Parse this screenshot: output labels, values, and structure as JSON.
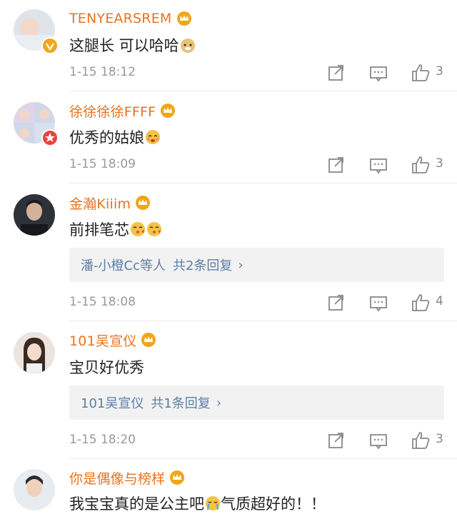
{
  "comments": [
    {
      "user": "TENYEARSREM",
      "text": "这腿长 可以哈哈",
      "emojis": [
        "doge-emoji"
      ],
      "time": "1-15 18:12",
      "likes": "3",
      "badge": "verified-v",
      "badge_color": "#f0a61b"
    },
    {
      "user": "徐徐徐徐FFFF",
      "text": "优秀的姑娘",
      "emojis": [
        "shy-emoji"
      ],
      "time": "1-15 18:09",
      "likes": "3",
      "badge": "star",
      "badge_color": "#e8433a"
    },
    {
      "user": "金瀚Kiiim",
      "text": "前排笔芯",
      "emojis": [
        "kiss-emoji",
        "kiss-emoji"
      ],
      "time": "1-15 18:08",
      "likes": "4",
      "replies": {
        "who": "潘-小橙Cc等人",
        "count": "共2条回复"
      }
    },
    {
      "user": "101吴宣仪",
      "text": "宝贝好优秀",
      "emojis": [],
      "time": "1-15 18:20",
      "likes": "3",
      "replies": {
        "who": "101吴宣仪",
        "count": "共1条回复"
      }
    },
    {
      "user": "你是偶像与榜样",
      "text": "我宝宝真的是公主吧",
      "text_after": "气质超好的！！",
      "emojis": [
        "cry-emoji"
      ]
    }
  ],
  "colors": {
    "username": "#e8731e",
    "reply_link": "#5b7fa6",
    "meta": "#999999",
    "crown": "#f0a61b"
  }
}
